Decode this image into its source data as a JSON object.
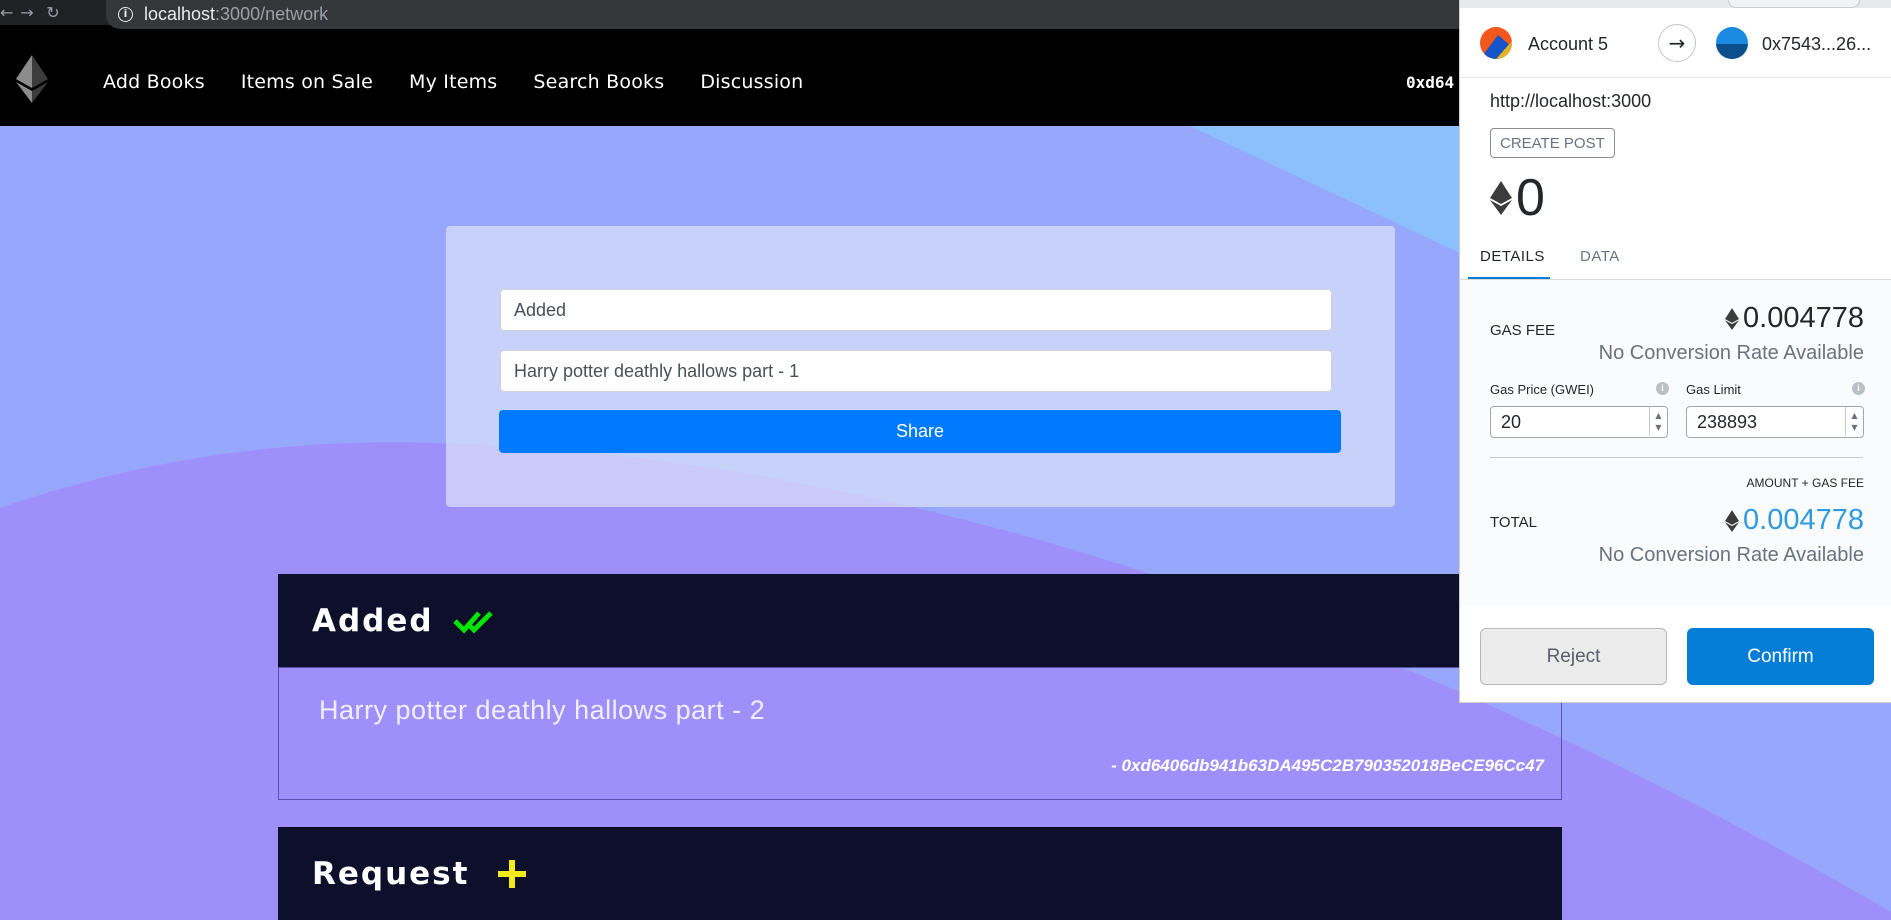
{
  "browser": {
    "url_host": "localhost",
    "url_path": ":3000/network"
  },
  "nav": {
    "items": [
      "Add Books",
      "Items on Sale",
      "My Items",
      "Search Books",
      "Discussion"
    ],
    "account_short": "0xd64"
  },
  "form": {
    "tag_value": "Added",
    "text_value": "Harry potter deathly hallows part - 1",
    "share_label": "Share"
  },
  "posts": [
    {
      "title": "Added",
      "icon": "double-check-icon",
      "icon_color": "#00e600",
      "text": "Harry potter deathly hallows part - 2",
      "author": "- 0xd6406db941b63DA495C2B790352018BeCE96Cc47"
    },
    {
      "title": "Request",
      "icon": "plus-icon",
      "icon_color": "#f2ea1b"
    }
  ],
  "metamask": {
    "from_account": "Account 5",
    "to_address": "0x7543...26...",
    "origin": "http://localhost:3000",
    "tx_type": "CREATE POST",
    "amount": "0",
    "tabs": [
      "DETAILS",
      "DATA"
    ],
    "gas_fee_label": "GAS FEE",
    "gas_fee_value": "0.004778",
    "no_conversion": "No Conversion Rate Available",
    "gas_price_label": "Gas Price (GWEI)",
    "gas_price_value": "20",
    "gas_limit_label": "Gas Limit",
    "gas_limit_value": "238893",
    "amount_gas_label": "AMOUNT + GAS FEE",
    "total_label": "TOTAL",
    "total_value": "0.004778",
    "reject_label": "Reject",
    "confirm_label": "Confirm"
  },
  "colors": {
    "accent_blue": "#007bff",
    "metamask_blue": "#037dd6",
    "dark_panel": "#0e0f2b",
    "background_lavender": "#97a7fb"
  }
}
